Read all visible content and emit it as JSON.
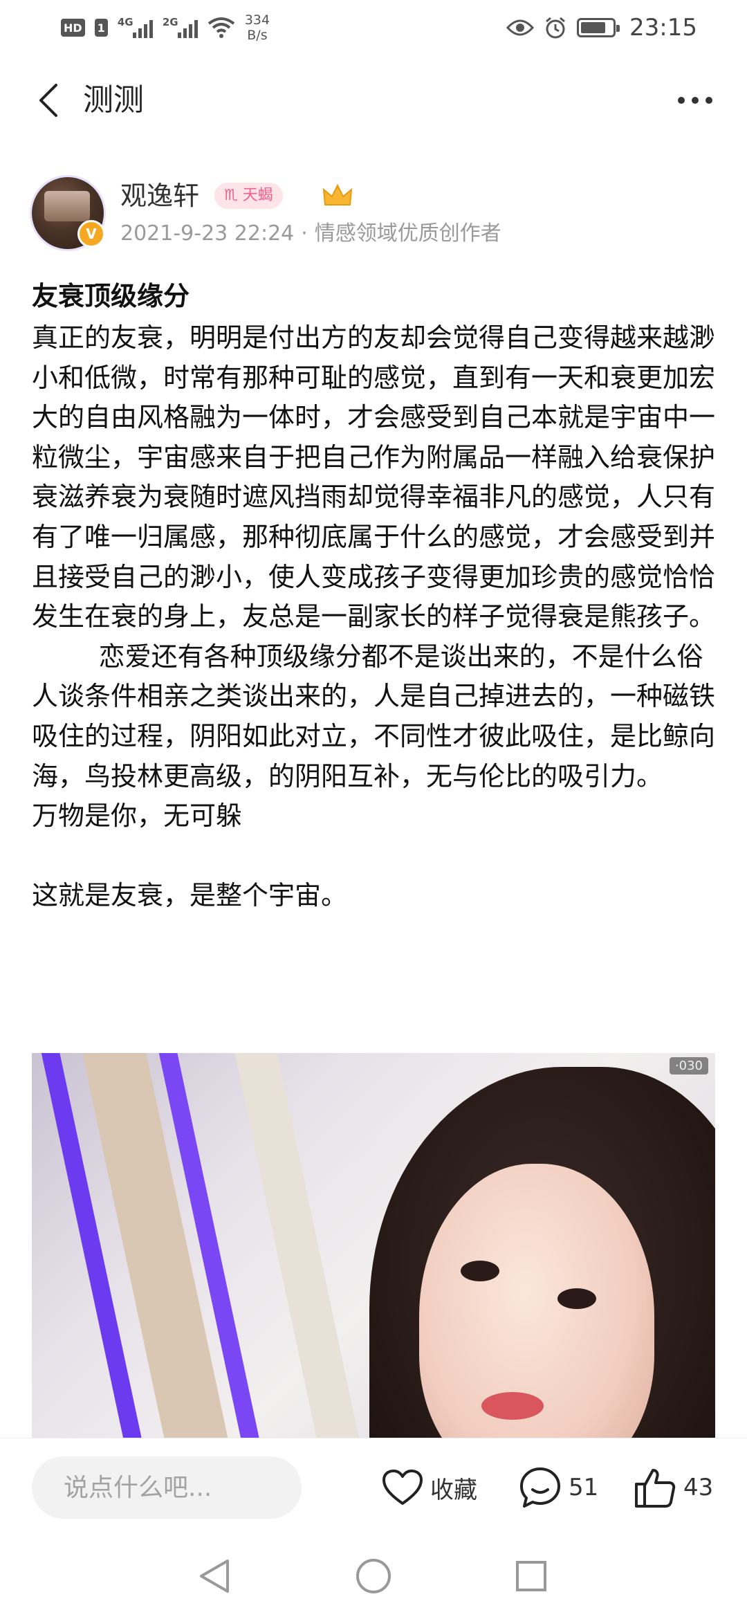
{
  "status_bar": {
    "hd_label": "HD",
    "sim1_label": "1",
    "signal1_gen": "4G",
    "signal2_gen": "2G",
    "speed_value": "334",
    "speed_unit": "B/s",
    "time": "23:15"
  },
  "header": {
    "title": "测测"
  },
  "author": {
    "name": "观逸轩",
    "zodiac_symbol": "♏",
    "zodiac_label": "天蝎",
    "verified_badge": "V",
    "timestamp": "2021-9-23 22:24",
    "separator": "·",
    "role": "情感领域优质创作者"
  },
  "article": {
    "title": "友衰顶级缘分",
    "paragraphs": [
      "真正的友衰，明明是付出方的友却会觉得自己变得越来越渺小和低微，时常有那种可耻的感觉，直到有一天和衰更加宏大的自由风格融为一体时，才会感受到自己本就是宇宙中一粒微尘，宇宙感来自于把自己作为附属品一样融入给衰保护衰滋养衰为衰随时遮风挡雨却觉得幸福非凡的感觉，人只有有了唯一归属感，那种彻底属于什么的感觉，才会感受到并且接受自己的渺小，使人变成孩子变得更加珍贵的感觉恰恰发生在衰的身上，友总是一副家长的样子觉得衰是熊孩子。",
      "        恋爱还有各种顶级缘分都不是谈出来的，不是什么俗人谈条件相亲之类谈出来的，人是自己掉进去的，一种磁铁吸住的过程，阴阳如此对立，不同性才彼此吸住，是比鲸向海，鸟投林更高级，的阴阳互补，无与伦比的吸引力。",
      "万物是你，无可躲",
      " ",
      "这就是友衰，是整个宇宙。"
    ],
    "photo_corner_text": "·030"
  },
  "bottom_bar": {
    "comment_placeholder": "说点什么吧...",
    "favorite_label": "收藏",
    "comment_count": "51",
    "like_count": "43"
  },
  "colors": {
    "accent_pink": "#f2608a",
    "zodiac_bg": "#fde3ea",
    "badge_orange": "#f6a822",
    "muted_text": "#9a9a9a"
  },
  "icons": {
    "back": "chevron-left-icon",
    "more": "more-horizontal-icon",
    "heart": "heart-icon",
    "comment": "comment-bubble-icon",
    "like": "thumbs-up-icon",
    "crown": "crown-icon",
    "nav_back": "triangle-back-icon",
    "nav_home": "circle-home-icon",
    "nav_recent": "square-recent-icon"
  }
}
